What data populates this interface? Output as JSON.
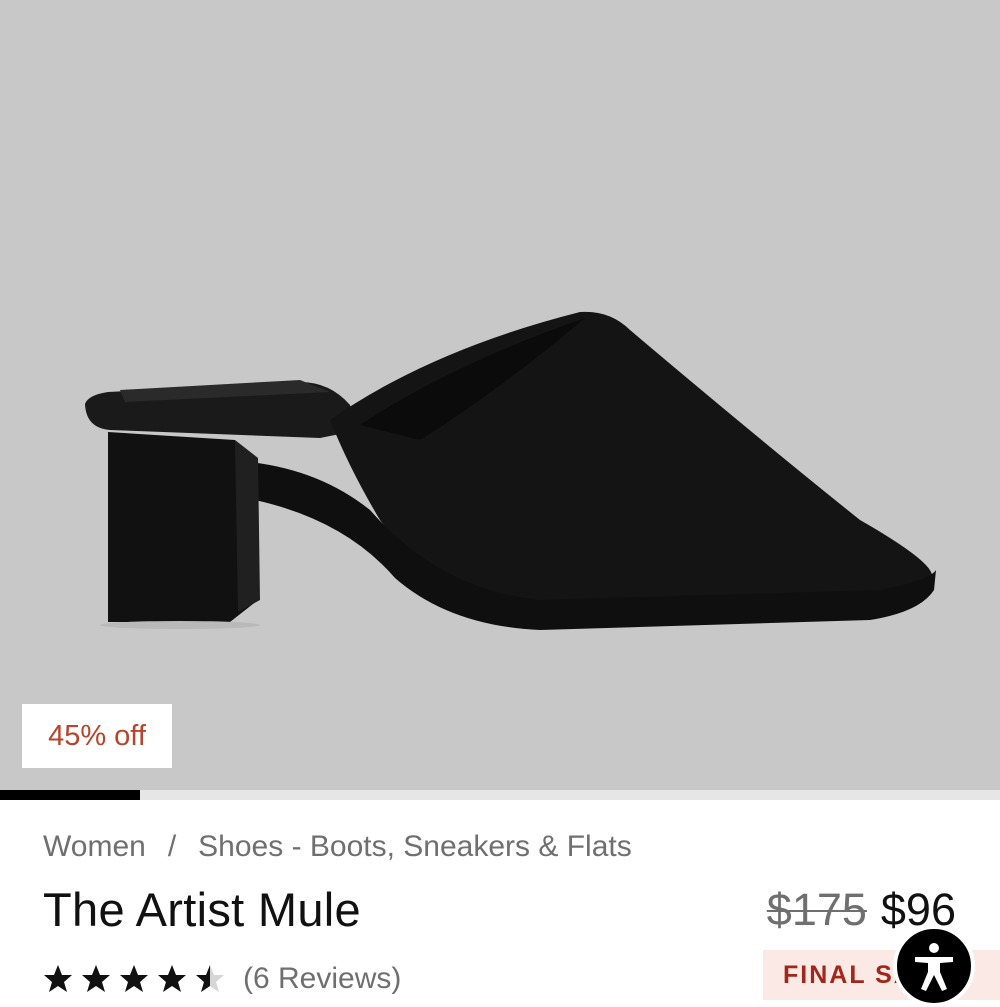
{
  "product": {
    "image_alt": "Black leather mule with block heel",
    "discount_badge": "45% off",
    "image_progress": 0.14,
    "title": "The Artist Mule",
    "price_original": "$175",
    "price_sale": "$96",
    "rating_value": 4.5,
    "rating_max": 5,
    "reviews_label": "(6 Reviews)",
    "sale_badge": "FINAL SALE"
  },
  "breadcrumb": {
    "items": [
      "Women",
      "Shoes - Boots, Sneakers & Flats"
    ],
    "separator": "/"
  },
  "icons": {
    "star": "star-icon",
    "accessibility": "accessibility-icon"
  },
  "colors": {
    "hero_bg": "#c8c8c8",
    "discount_text": "#b8442b",
    "sale_badge_bg": "#fbe9e6",
    "sale_badge_text": "#a0281a"
  }
}
